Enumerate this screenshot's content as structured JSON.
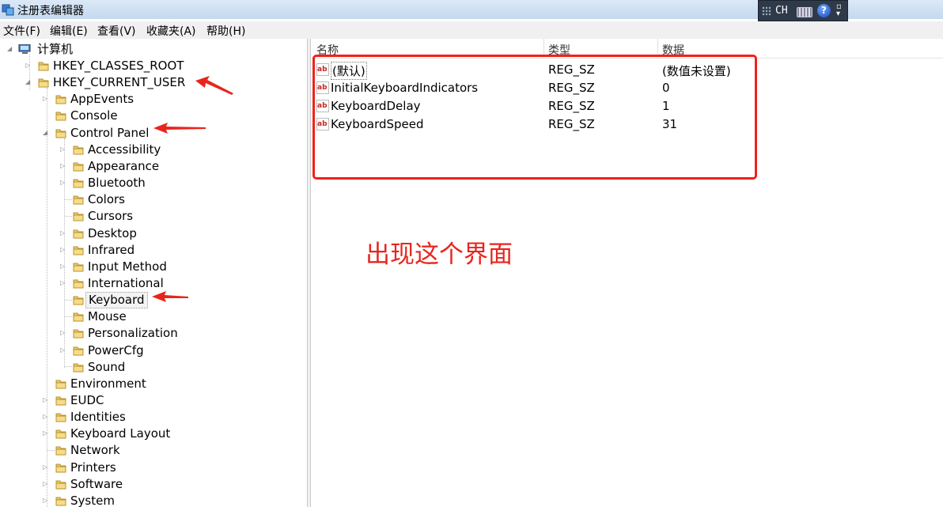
{
  "window": {
    "title": "注册表编辑器",
    "app_icon": "regedit-icon"
  },
  "language_bar": {
    "language": "CH",
    "icons": [
      "grip-icon",
      "keyboard-icon",
      "help-icon",
      "options-icon"
    ],
    "help_glyph": "?"
  },
  "menu": [
    "文件(F)",
    "编辑(E)",
    "查看(V)",
    "收藏夹(A)",
    "帮助(H)"
  ],
  "tree": {
    "root": "计算机",
    "nodes": [
      {
        "label": "HKEY_CLASSES_ROOT"
      },
      {
        "label": "HKEY_CURRENT_USER"
      },
      {
        "label": "AppEvents"
      },
      {
        "label": "Console"
      },
      {
        "label": "Control Panel"
      },
      {
        "label": "Accessibility"
      },
      {
        "label": "Appearance"
      },
      {
        "label": "Bluetooth"
      },
      {
        "label": "Colors"
      },
      {
        "label": "Cursors"
      },
      {
        "label": "Desktop"
      },
      {
        "label": "Infrared"
      },
      {
        "label": "Input Method"
      },
      {
        "label": "International"
      },
      {
        "label": "Keyboard",
        "selected": true
      },
      {
        "label": "Mouse"
      },
      {
        "label": "Personalization"
      },
      {
        "label": "PowerCfg"
      },
      {
        "label": "Sound"
      },
      {
        "label": "Environment"
      },
      {
        "label": "EUDC"
      },
      {
        "label": "Identities"
      },
      {
        "label": "Keyboard Layout"
      },
      {
        "label": "Network"
      },
      {
        "label": "Printers"
      },
      {
        "label": "Software"
      },
      {
        "label": "System"
      }
    ]
  },
  "list": {
    "columns": [
      "名称",
      "类型",
      "数据"
    ],
    "rows": [
      {
        "name": "(默认)",
        "type": "REG_SZ",
        "data": "(数值未设置)"
      },
      {
        "name": "InitialKeyboardIndicators",
        "type": "REG_SZ",
        "data": "0"
      },
      {
        "name": "KeyboardDelay",
        "type": "REG_SZ",
        "data": "1"
      },
      {
        "name": "KeyboardSpeed",
        "type": "REG_SZ",
        "data": "31"
      }
    ]
  },
  "annotation": {
    "caption": "出现这个界面",
    "color": "#e8251c"
  }
}
